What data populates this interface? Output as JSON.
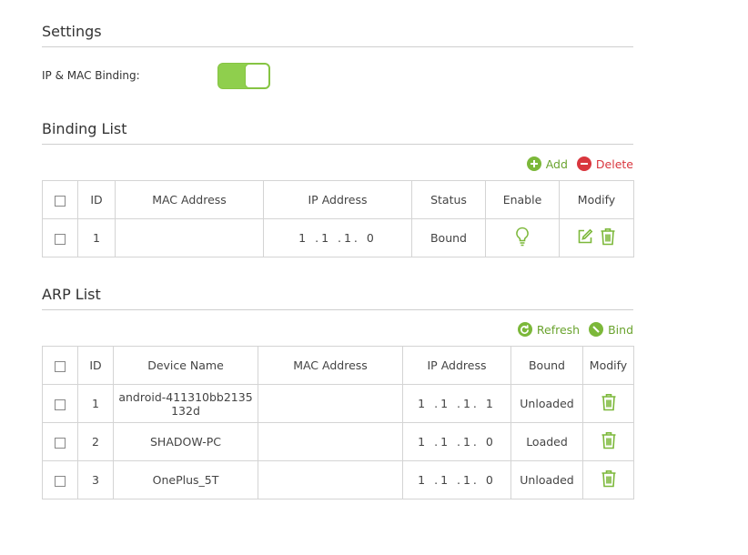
{
  "settings": {
    "title": "Settings",
    "binding_label": "IP & MAC Binding:",
    "binding_enabled": true
  },
  "binding_list": {
    "title": "Binding List",
    "add_label": "Add",
    "delete_label": "Delete",
    "columns": [
      "ID",
      "MAC Address",
      "IP Address",
      "Status",
      "Enable",
      "Modify"
    ],
    "rows": [
      {
        "id": "1",
        "mac": "",
        "ip": "1 .1 .1. 0",
        "status": "Bound",
        "enable_icon": "bulb-icon"
      }
    ]
  },
  "arp_list": {
    "title": "ARP List",
    "refresh_label": "Refresh",
    "bind_label": "Bind",
    "columns": [
      "ID",
      "Device Name",
      "MAC Address",
      "IP Address",
      "Bound",
      "Modify"
    ],
    "rows": [
      {
        "id": "1",
        "device": "android-411310bb2135132d",
        "mac": "",
        "ip": "1 .1 .1. 1",
        "bound": "Unloaded"
      },
      {
        "id": "2",
        "device": "SHADOW-PC",
        "mac": "",
        "ip": "1 .1 .1. 0",
        "bound": "Loaded"
      },
      {
        "id": "3",
        "device": "OnePlus_5T",
        "mac": "",
        "ip": "1 .1 .1. 0",
        "bound": "Unloaded"
      }
    ]
  },
  "colors": {
    "accent_green": "#7cb83a",
    "delete_red": "#d9363e",
    "border": "#d4d4d4"
  }
}
